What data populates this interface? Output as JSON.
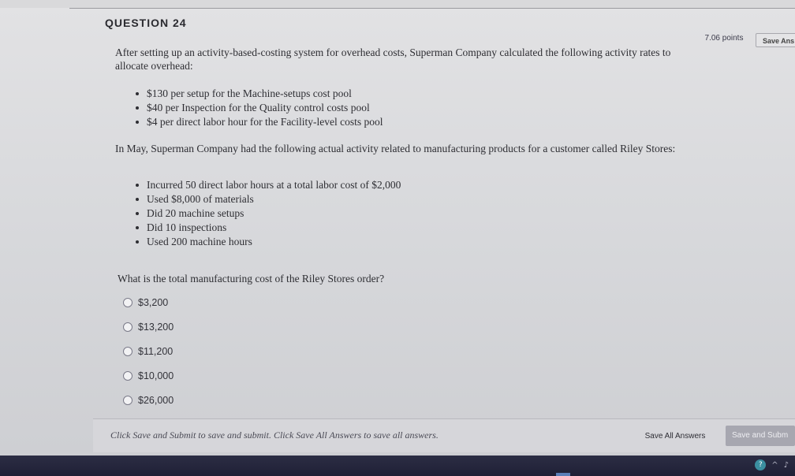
{
  "question": {
    "header": "QUESTION 24",
    "points": "7.06 points",
    "save_answer_label": "Save Ans",
    "intro": "After setting up an activity-based-costing system for overhead costs, Superman Company calculated the following activity rates to allocate overhead:",
    "rates": [
      "$130 per setup for the Machine-setups cost pool",
      "$40 per Inspection for the Quality control costs pool",
      "$4 per direct labor hour for the Facility-level costs pool"
    ],
    "activity_intro": "In May, Superman Company had the following actual activity related to manufacturing products for a customer called Riley Stores:",
    "activities": [
      "Incurred 50 direct labor hours at a total labor cost of $2,000",
      "Used $8,000 of materials",
      "Did 20 machine setups",
      "Did 10 inspections",
      "Used 200 machine hours"
    ],
    "prompt": "What is the total manufacturing cost of the Riley Stores order?",
    "options": [
      "$3,200",
      "$13,200",
      "$11,200",
      "$10,000",
      "$26,000"
    ]
  },
  "footer": {
    "instructions": "Click Save and Submit to save and submit. Click Save All Answers to save all answers.",
    "save_all_label": "Save All Answers",
    "save_submit_label": "Save and Subm"
  },
  "icons": {
    "tray_help": "help-icon",
    "tray_up": "chevron-up-icon",
    "tray_volume": "volume-icon"
  }
}
